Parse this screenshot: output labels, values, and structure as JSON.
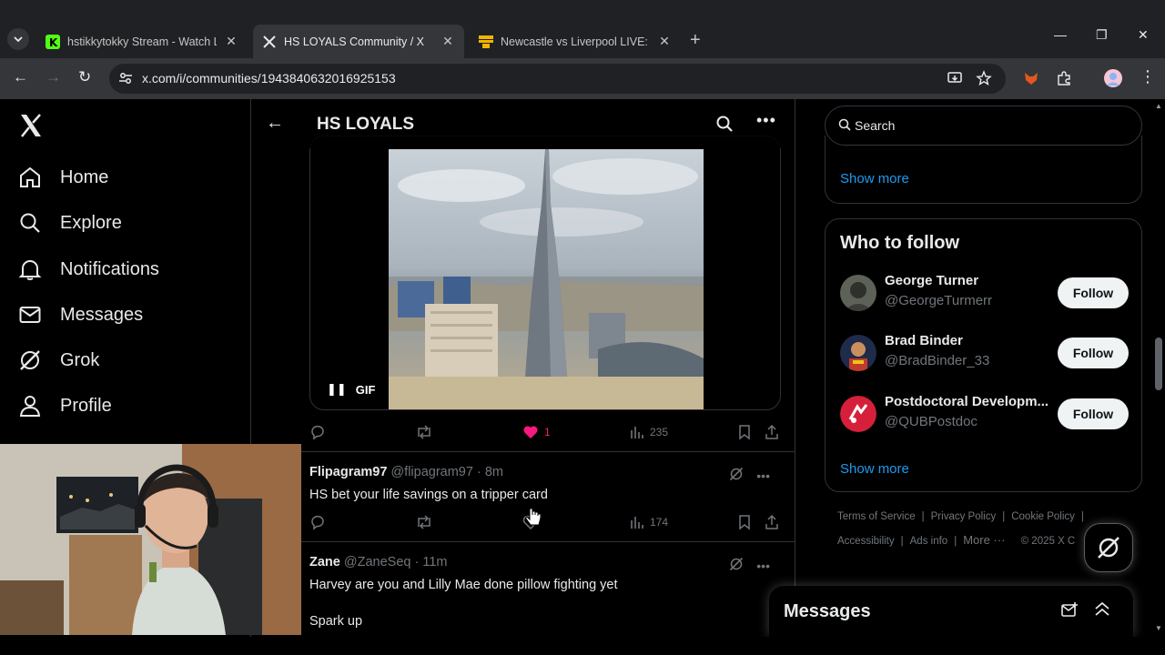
{
  "browser": {
    "tabs": [
      {
        "title": "hstikkytokky Stream - Watch Li...",
        "favicon": "kick-icon",
        "active": false
      },
      {
        "title": "HS LOYALS Community / X",
        "favicon": "x-icon",
        "active": true
      },
      {
        "title": "Newcastle vs Liverpool LIVE: Pre...",
        "favicon": "news-icon",
        "active": false
      }
    ],
    "url": "x.com/i/communities/1943840632016925153"
  },
  "nav": {
    "items": [
      {
        "label": "Home",
        "icon": "home-icon"
      },
      {
        "label": "Explore",
        "icon": "search-icon"
      },
      {
        "label": "Notifications",
        "icon": "bell-icon"
      },
      {
        "label": "Messages",
        "icon": "envelope-icon"
      },
      {
        "label": "Grok",
        "icon": "grok-icon"
      },
      {
        "label": "Profile",
        "icon": "person-icon"
      }
    ]
  },
  "community": {
    "title": "HS LOYALS"
  },
  "gif_post": {
    "badge": "GIF",
    "likes": "1",
    "views": "235"
  },
  "posts": [
    {
      "name": "Flipagram97",
      "handle": "@flipagram97",
      "time": "8m",
      "text": "HS bet your life savings on a tripper card",
      "views": "174"
    },
    {
      "name": "Zane",
      "handle": "@ZaneSeq",
      "time": "11m",
      "text_line1": "Harvey are you and Lilly Mae done pillow fighting yet",
      "text_line2": "Spark up"
    }
  ],
  "right": {
    "search_placeholder": "Search",
    "show_more": "Show more",
    "who_to_follow_title": "Who to follow",
    "follow_label": "Follow",
    "suggestions": [
      {
        "name": "George Turner",
        "handle": "@GeorgeTurmerr"
      },
      {
        "name": "Brad Binder",
        "handle": "@BradBinder_33"
      },
      {
        "name": "Postdoctoral Developm...",
        "handle": "@QUBPostdoc"
      }
    ],
    "show_more_2": "Show more",
    "footer": {
      "terms": "Terms of Service",
      "privacy": "Privacy Policy",
      "cookie": "Cookie Policy",
      "accessibility": "Accessibility",
      "ads": "Ads info",
      "more": "More ···",
      "copyright": "© 2025 X C"
    }
  },
  "messages_drawer": {
    "title": "Messages"
  },
  "colors": {
    "accent": "#1d9bf0",
    "like": "#f91880",
    "background": "#000000",
    "border": "#2f3336"
  }
}
